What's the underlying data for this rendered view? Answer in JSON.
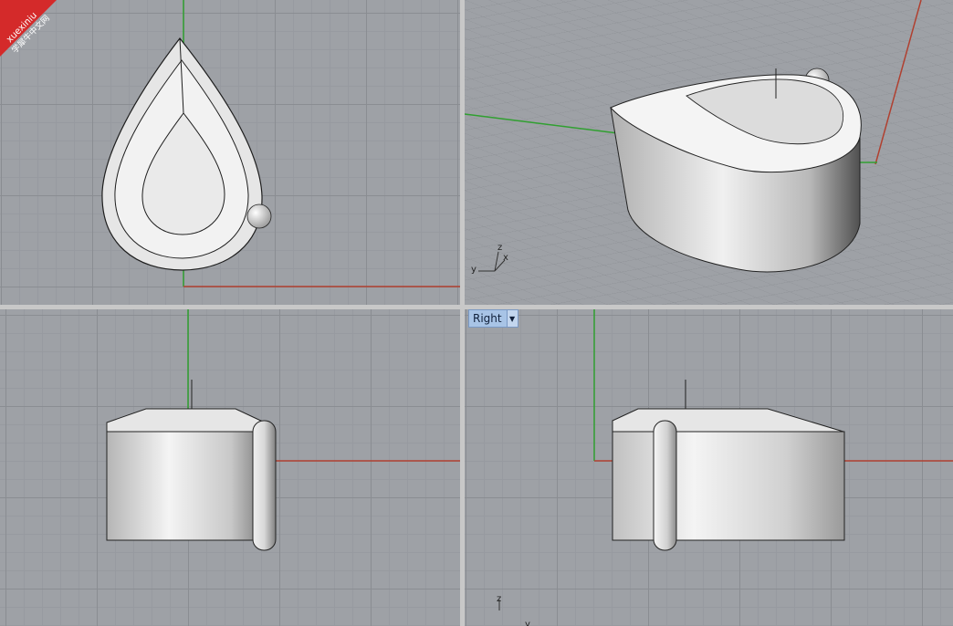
{
  "watermark": {
    "line1": "xuexiniu",
    "line2": "学犀牛中文网",
    "color": "#d42a2a"
  },
  "viewports": {
    "top": {
      "name": "top-viewport"
    },
    "perspective": {
      "axis_labels": {
        "z": "z",
        "x": "x",
        "y": "y"
      }
    },
    "front": {
      "name": "front-viewport"
    },
    "right": {
      "label": "Right",
      "dropdown_glyph": "▼",
      "axis_labels": {
        "z": "z",
        "y": "y"
      }
    }
  },
  "colors": {
    "x_axis": "#b04030",
    "y_axis": "#30a030",
    "viewport_bg": "#9ea1a6",
    "active_label": "#a8c4e6"
  }
}
